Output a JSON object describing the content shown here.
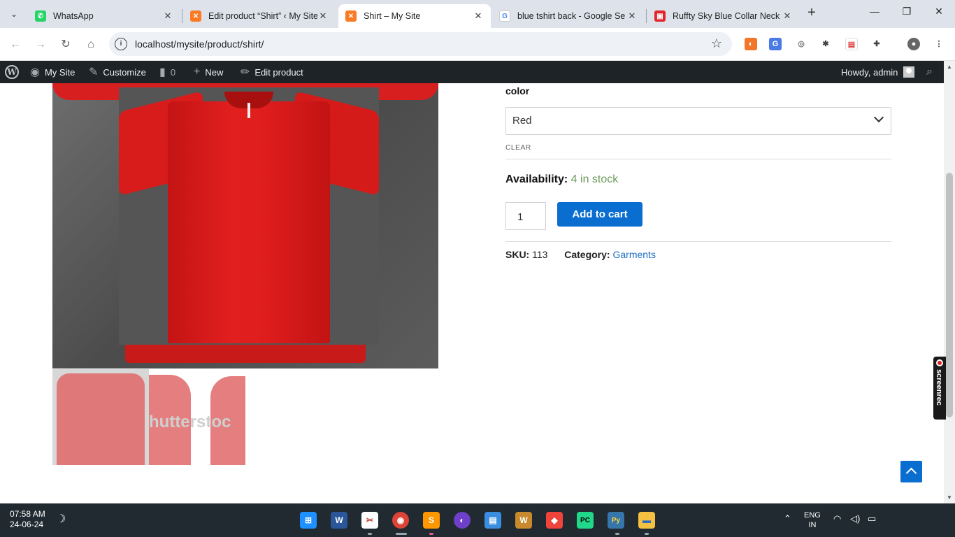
{
  "browser": {
    "tabs": [
      {
        "title": "WhatsApp",
        "favicon": "whatsapp-icon",
        "color": "#25d366",
        "glyph": "✆"
      },
      {
        "title": "Edit product “Shirt” ‹ My Site",
        "favicon": "xampp-icon",
        "color": "#fb7a24",
        "glyph": "✕"
      },
      {
        "title": "Shirt – My Site",
        "favicon": "xampp-icon",
        "color": "#fb7a24",
        "glyph": "✕"
      },
      {
        "title": "blue tshirt back - Google Se",
        "favicon": "google-icon",
        "color": "#4285f4",
        "glyph": "G"
      },
      {
        "title": "Ruffty Sky Blue Collar Neck T",
        "favicon": "store-icon",
        "color": "#e0252b",
        "glyph": "▣"
      }
    ],
    "url": "localhost/mysite/product/shirt/"
  },
  "adminbar": {
    "site": "My Site",
    "customize": "Customize",
    "comments": "0",
    "new": "New",
    "edit": "Edit product",
    "howdy": "Howdy, admin"
  },
  "product": {
    "attribute_label": "color",
    "selected_color": "Red",
    "clear": "CLEAR",
    "availability_label": "Availability:",
    "stock": "4 in stock",
    "quantity": "1",
    "add_to_cart": "Add to cart",
    "sku_label": "SKU:",
    "sku": "113",
    "category_label": "Category:",
    "category": "Garments"
  },
  "thumbnail_watermark": "hutterstoc",
  "screenrec": "screenrec",
  "taskbar": {
    "time": "07:58 AM",
    "date": "24-06-24",
    "lang_top": "ENG",
    "lang_bottom": "IN",
    "apps": [
      {
        "name": "start",
        "color": "#1e90ff",
        "glyph": "⊞"
      },
      {
        "name": "word",
        "color": "#2b579a",
        "glyph": "W"
      },
      {
        "name": "snipping",
        "color": "#c0392b",
        "glyph": "✂"
      },
      {
        "name": "chrome",
        "color": "#db4437",
        "glyph": "◉"
      },
      {
        "name": "sublime",
        "color": "#ff9800",
        "glyph": "S"
      },
      {
        "name": "github",
        "color": "#6e40c9",
        "glyph": "◐"
      },
      {
        "name": "notepad",
        "color": "#3b8de0",
        "glyph": "▤"
      },
      {
        "name": "wordpad",
        "color": "#c88a2c",
        "glyph": "W"
      },
      {
        "name": "anydesk",
        "color": "#ef443b",
        "glyph": "◆"
      },
      {
        "name": "pycharm",
        "color": "#21d789",
        "glyph": "PC"
      },
      {
        "name": "python",
        "color": "#3776ab",
        "glyph": "Py"
      },
      {
        "name": "explorer",
        "color": "#f5c142",
        "glyph": "▬"
      }
    ]
  }
}
